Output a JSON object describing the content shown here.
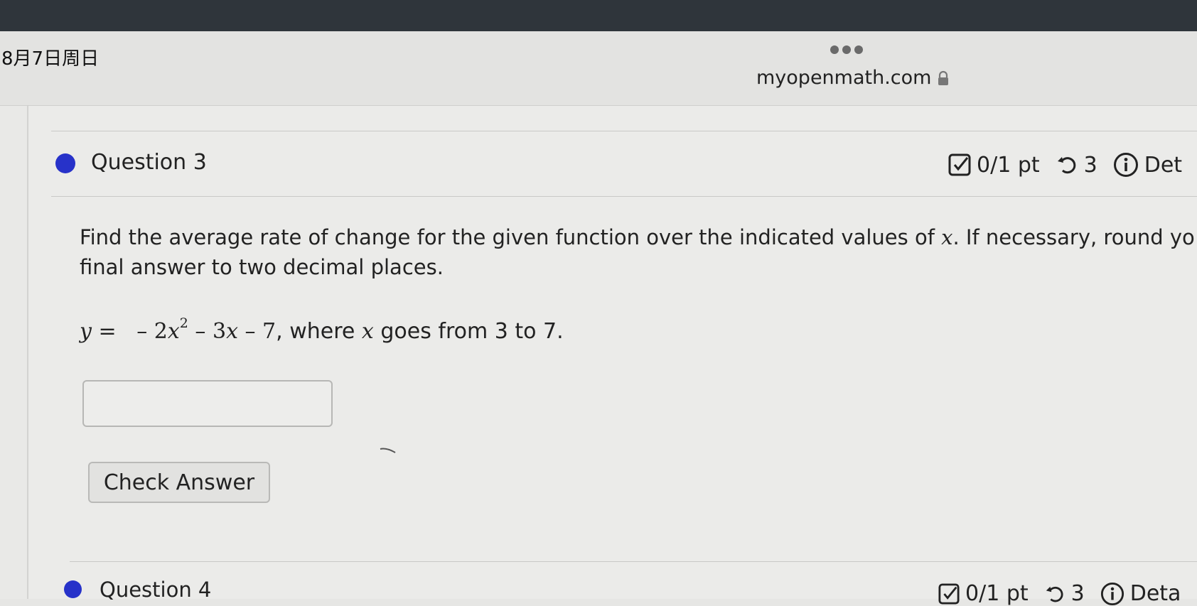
{
  "status_bar": {
    "date": "8月7日周日",
    "url": "myopenmath.com"
  },
  "questions": [
    {
      "title": "Question 3",
      "score": "0/1 pt",
      "retries": "3",
      "details_label": "Det"
    },
    {
      "title": "Question 4",
      "score": "0/1 pt",
      "retries": "3",
      "details_label": "Deta"
    }
  ],
  "prompt": {
    "line1_before": "Find the average rate of change for the given function over the indicated values of ",
    "variable": "x",
    "line1_after": ". If necessary, round yo",
    "line2": "final answer to two decimal places."
  },
  "formula": {
    "lhs": "y",
    "equals": "=",
    "part1": "– 2",
    "var1": "x",
    "exp": "2",
    "part2": " – 3",
    "var2": "x",
    "part3": " – 7",
    "suffix_before": ", where ",
    "var3": "x",
    "suffix_after": " goes from 3 to 7."
  },
  "answer": {
    "value": "",
    "placeholder": ""
  },
  "buttons": {
    "check_answer": "Check Answer"
  },
  "colors": {
    "question_dot": "#2732c9",
    "bezel": "#2f353b"
  }
}
